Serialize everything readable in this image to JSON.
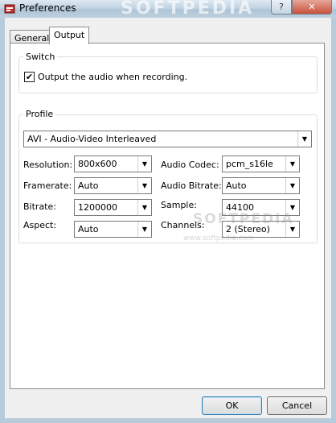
{
  "window": {
    "title": "Preferences",
    "watermark": "SOFTPEDIA",
    "help_glyph": "?",
    "close_glyph": "✕",
    "app_icon": "preferences-app-icon"
  },
  "tabs": [
    {
      "label": "General",
      "active": false
    },
    {
      "label": "Output",
      "active": true
    }
  ],
  "switch_group": {
    "legend": "Switch",
    "checkbox": {
      "label": "Output the audio when recording.",
      "checked": true,
      "glyph": "✔"
    }
  },
  "profile_group": {
    "legend": "Profile",
    "profile_select": {
      "value": "AVI - Audio-Video Interleaved"
    },
    "video": [
      {
        "label": "Resolution:",
        "value": "800x600"
      },
      {
        "label": "Framerate:",
        "value": "Auto"
      },
      {
        "label": "Bitrate:",
        "value": "1200000"
      },
      {
        "label": "Aspect:",
        "value": "Auto"
      }
    ],
    "audio": [
      {
        "label": "Audio Codec:",
        "value": "pcm_s16le"
      },
      {
        "label": "Audio Bitrate:",
        "value": "Auto"
      },
      {
        "label": "Sample:",
        "value": "44100"
      },
      {
        "label": "Channels:",
        "value": "2 (Stereo)"
      }
    ],
    "arrow_glyph": "▼"
  },
  "panel_watermark": {
    "main": "SOFTPEDIA",
    "sub": "www.softpedia.com"
  },
  "buttons": {
    "ok": "OK",
    "cancel": "Cancel"
  },
  "colors": {
    "accent": "#3c7fb1",
    "titlebar": "#c2d4e3",
    "close": "#c9503a"
  }
}
